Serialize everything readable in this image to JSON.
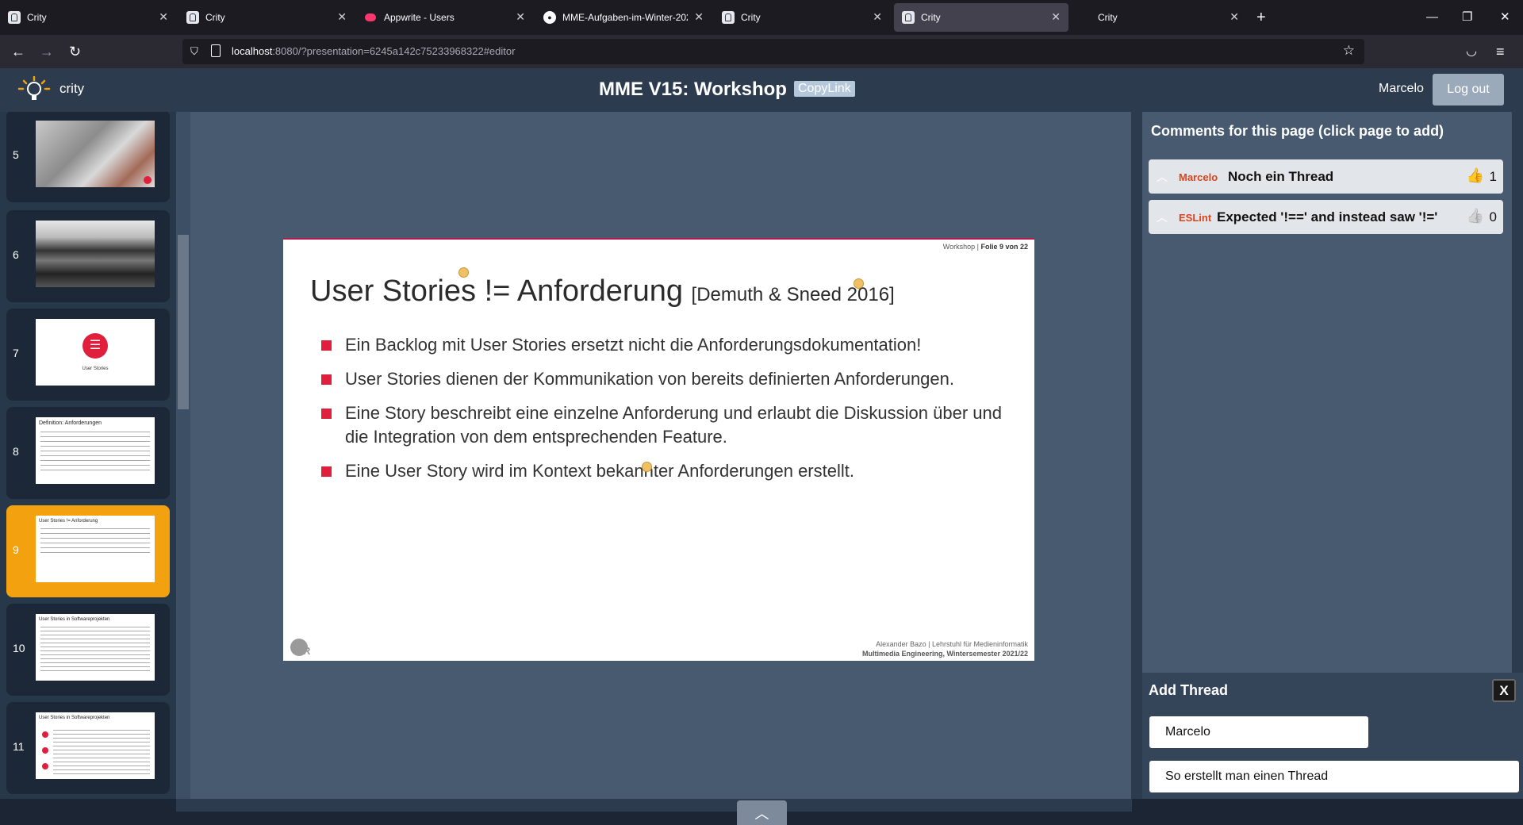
{
  "browser": {
    "tabs": [
      {
        "title": "Crity",
        "icon": "crity-icon",
        "active": false
      },
      {
        "title": "Crity",
        "icon": "crity-icon",
        "active": false
      },
      {
        "title": "Appwrite - Users",
        "icon": "appwrite-icon",
        "active": false
      },
      {
        "title": "MME-Aufgaben-im-Winter-2021",
        "icon": "github-icon",
        "active": false
      },
      {
        "title": "Crity",
        "icon": "crity-icon",
        "active": false
      },
      {
        "title": "Crity",
        "icon": "crity-icon",
        "active": true
      },
      {
        "title": "Crity",
        "icon": "none",
        "active": false
      }
    ],
    "url_host": "localhost",
    "url_rest": ":8080/?presentation=6245a142c75233968322#editor"
  },
  "header": {
    "brand": "crity",
    "title": "MME V15: Workshop",
    "copylink": "CopyLink",
    "username": "Marcelo",
    "logout": "Log out"
  },
  "slides": [
    {
      "num": "5",
      "kind": "photo"
    },
    {
      "num": "6",
      "kind": "typewriter"
    },
    {
      "num": "7",
      "kind": "icon",
      "caption": "User Stories"
    },
    {
      "num": "8",
      "kind": "text",
      "heading": "Definition: Anforderungen"
    },
    {
      "num": "9",
      "kind": "text",
      "heading": "User Stories != Anforderung",
      "active": true
    },
    {
      "num": "10",
      "kind": "text",
      "heading": "User Stories in Softwareprojekten"
    },
    {
      "num": "11",
      "kind": "text",
      "heading": "User Stories in Softwareprojekten"
    }
  ],
  "current_slide": {
    "header_left": "Workshop",
    "header_right": "Folie 9 von 22",
    "title": "User Stories != Anforderung",
    "citation": "[Demuth & Sneed 2016]",
    "bullets": [
      "Ein Backlog mit User Stories ersetzt nicht die Anforderungsdokumentation!",
      "User Stories dienen der Kommunikation von bereits definierten Anforderungen.",
      "Eine Story beschreibt eine einzelne Anforderung und erlaubt die Diskussion über und die Integration von dem entsprechenden Feature.",
      "Eine User Story wird im Kontext bekannter Anforderungen erstellt."
    ],
    "footer_line1": "Alexander Bazo | Lehrstuhl für Medieninformatik",
    "footer_line2": "Multimedia Engineering, Wintersemester 2021/22"
  },
  "comments": {
    "heading": "Comments for this page (click page to add)",
    "threads": [
      {
        "author": "Marcelo",
        "text": "Noch ein Thread",
        "likes": "1",
        "liked": true
      },
      {
        "author": "ESLint",
        "text": "Expected '!==' and instead saw '!='",
        "likes": "0",
        "liked": false
      }
    ]
  },
  "add_thread": {
    "heading": "Add Thread",
    "close": "X",
    "author_value": "Marcelo",
    "text_value": "So erstellt man einen Thread"
  },
  "colors": {
    "accent": "#f3a10e",
    "header_bg": "#2d3b4f",
    "slide_bullet": "#e01f3d",
    "author_name": "#d9441c"
  }
}
